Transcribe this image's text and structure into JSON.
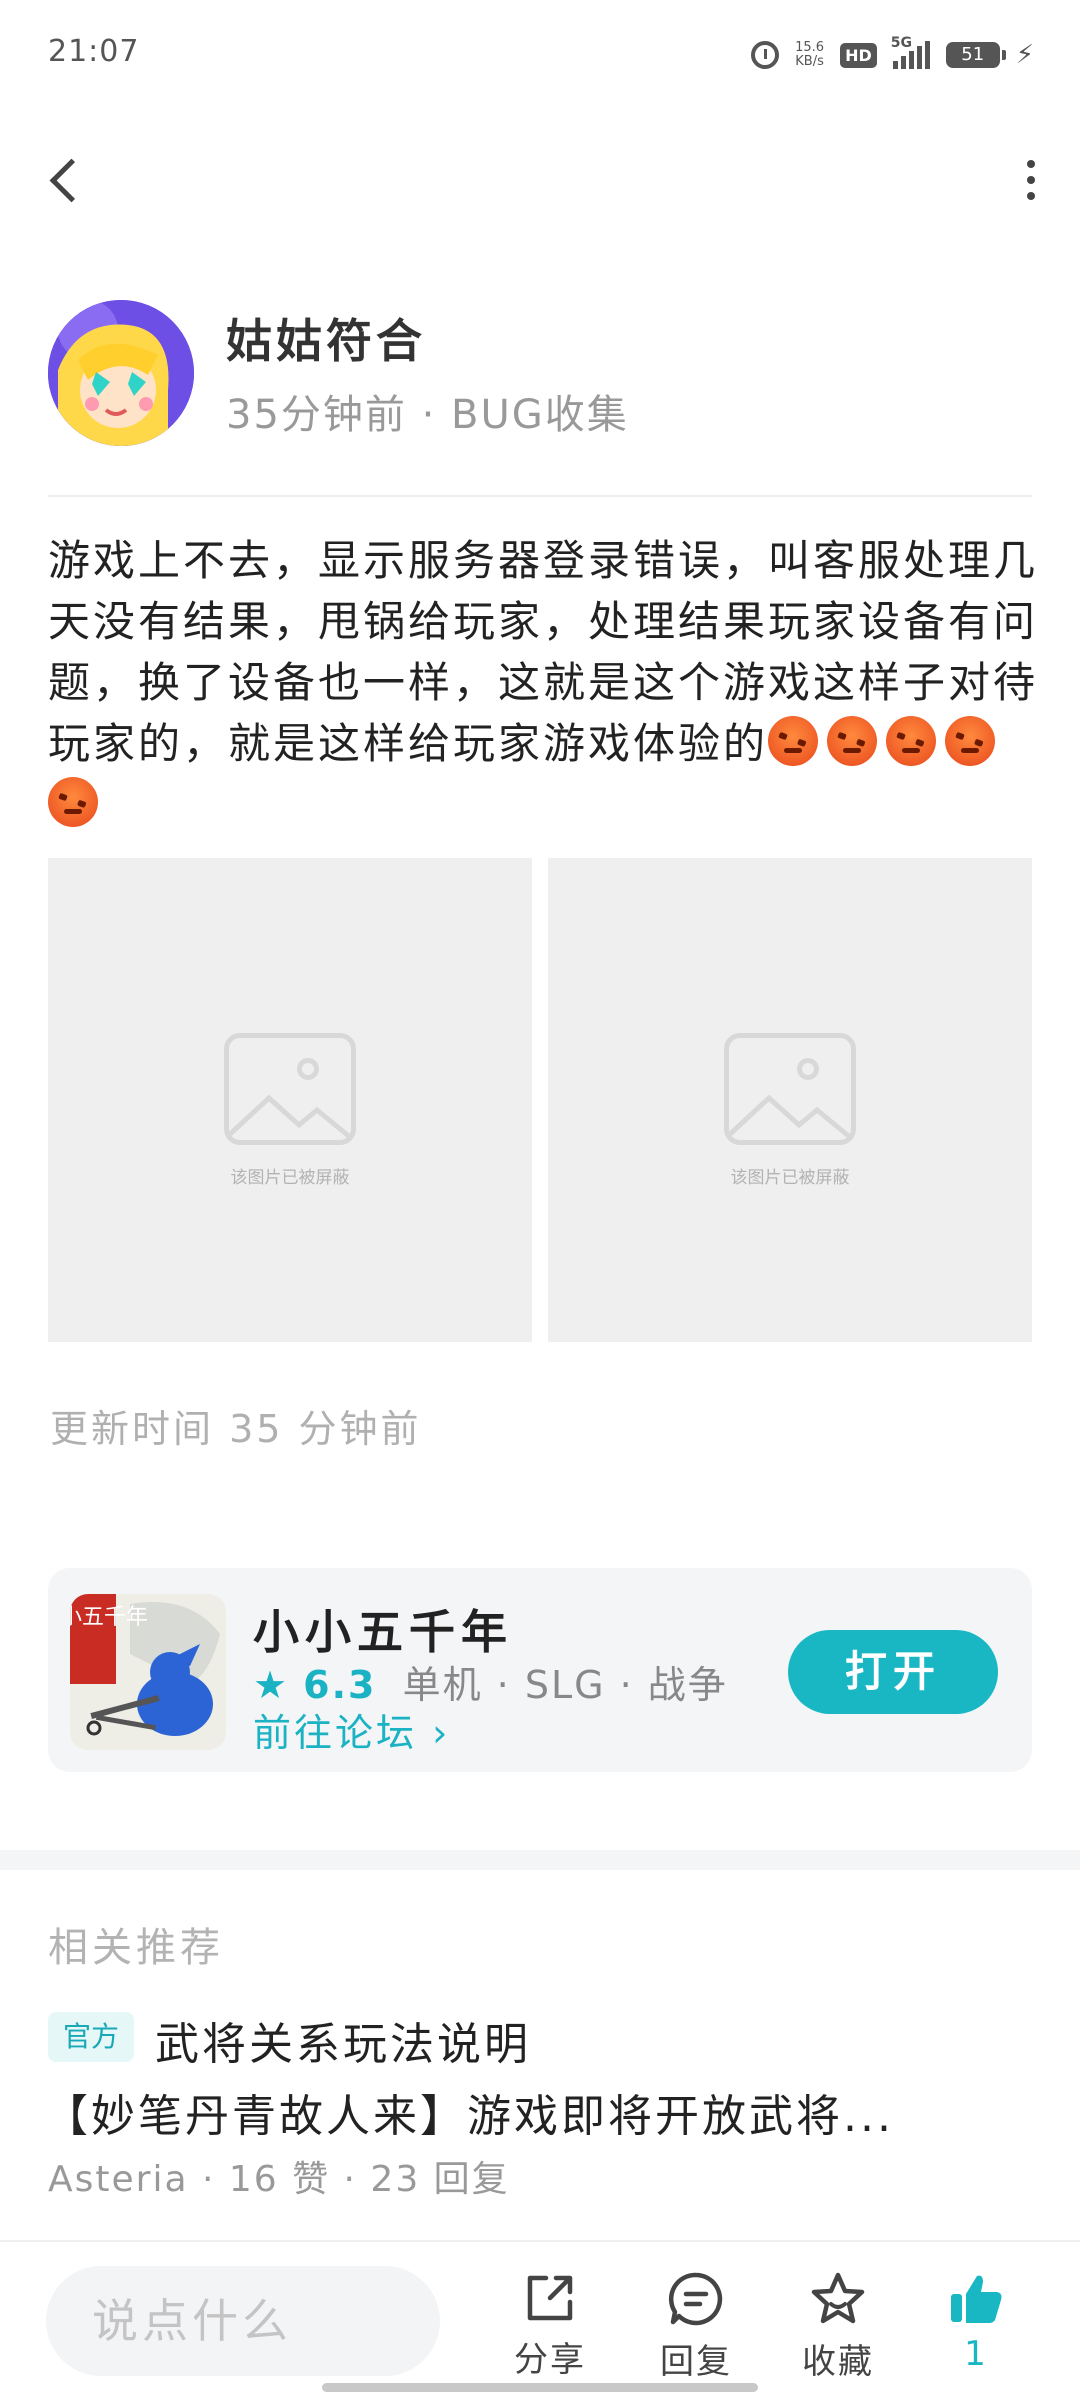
{
  "status_bar": {
    "time": "21:07",
    "speed_top": "15.6",
    "speed_unit": "KB/s",
    "hd": "HD",
    "network": "5G",
    "battery": "51"
  },
  "author": {
    "name": "姑姑符合",
    "meta": "35分钟前 · BUG收集"
  },
  "post": {
    "text": "游戏上不去，显示服务器登录错误，叫客服处理几天没有结果，甩锅给玩家，处理结果玩家设备有问题，换了设备也一样，这就是这个游戏这样子对待玩家的，就是这样给玩家游戏体验的",
    "emoji_count": 5,
    "images": [
      {
        "caption": "该图片已被屏蔽"
      },
      {
        "caption": "该图片已被屏蔽"
      }
    ],
    "update_time": "更新时间 35 分钟前"
  },
  "game": {
    "name": "小小五千年",
    "rating": "6.3",
    "tags": "单机 · SLG · 战争",
    "forum_link": "前往论坛 ›",
    "open_label": "打开",
    "icon_text": "小小五千年"
  },
  "related": {
    "title": "相关推荐",
    "items": [
      {
        "tag": "官方",
        "title": "武将关系玩法说明",
        "desc": "【妙笔丹青故人来】游戏即将开放武将...",
        "meta": "Asteria · 16 赞 · 23 回复"
      }
    ]
  },
  "bottom_bar": {
    "input_placeholder": "说点什么",
    "share_label": "分享",
    "reply_label": "回复",
    "favorite_label": "收藏",
    "like_count": "1",
    "accent_color": "#19b7c3"
  }
}
